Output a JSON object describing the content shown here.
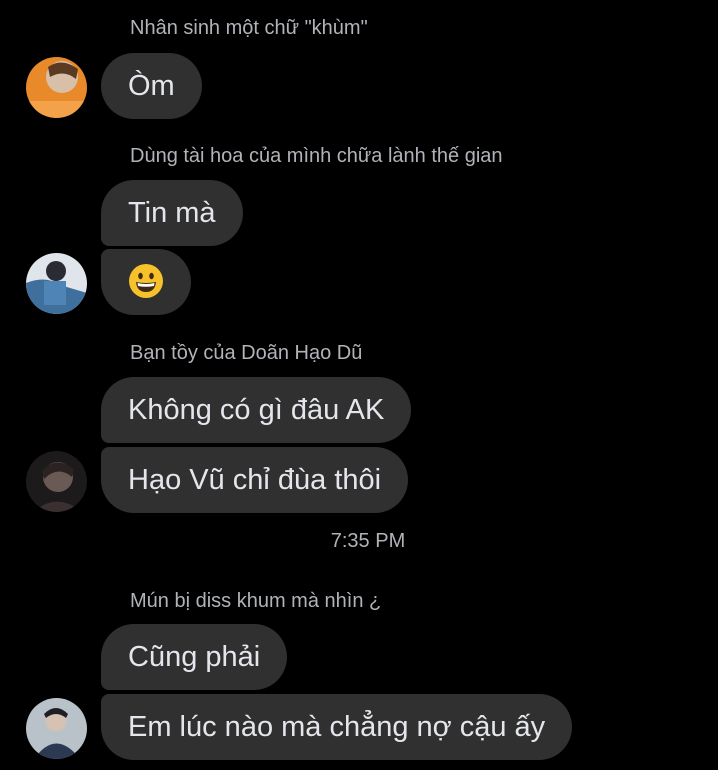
{
  "thread": {
    "groups": [
      {
        "sender": "Nhân sinh một chữ \"khùm\"",
        "messages": [
          "Òm"
        ]
      },
      {
        "sender": "Dùng tài hoa của mình chữa lành thế gian",
        "messages": [
          "Tin mà",
          "😀"
        ]
      },
      {
        "sender": "Bạn tồy của Doãn Hạo Dũ",
        "messages": [
          "Không có gì đâu AK",
          "Hạo Vũ chỉ đùa thôi"
        ]
      },
      {
        "sender": "Mún bị diss khum mà nhìn ¿",
        "messages": [
          "Cũng phải",
          "Em lúc nào mà chẳng nợ cậu ấy"
        ]
      }
    ],
    "timestamp": "7:35 PM"
  },
  "avatars": [
    {
      "icon": "avatar-orange-photo",
      "accent": "#e8892a"
    },
    {
      "icon": "avatar-denim-photo",
      "accent": "#3f6f9c"
    },
    {
      "icon": "avatar-dark-portrait",
      "accent": "#6a5a55"
    },
    {
      "icon": "avatar-dark-blue-portrait",
      "accent": "#2b3a52"
    }
  ],
  "colors": {
    "background": "#000000",
    "bubble": "#303030",
    "text": "#e4e6eb",
    "muted": "#b0b3b8"
  }
}
